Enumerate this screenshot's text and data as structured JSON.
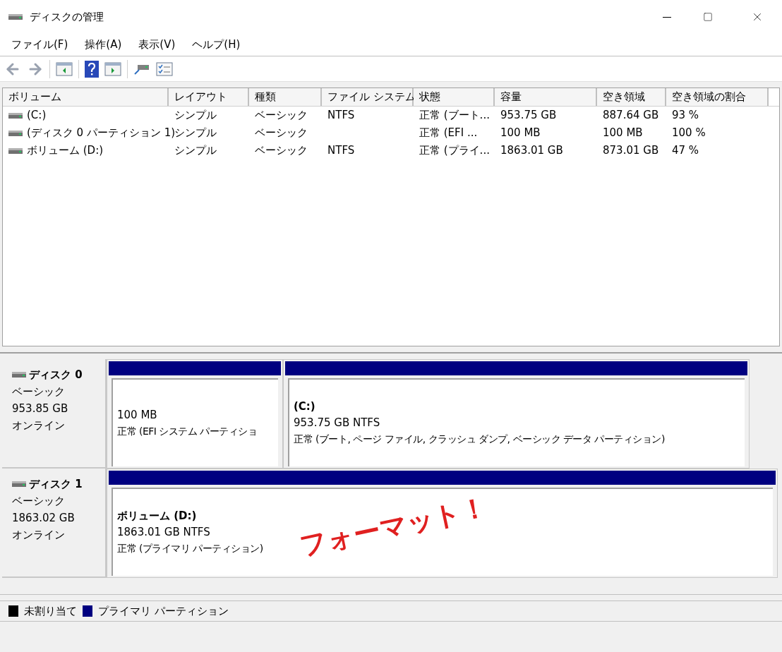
{
  "window": {
    "title": "ディスクの管理"
  },
  "menu": [
    "ファイル(F)",
    "操作(A)",
    "表示(V)",
    "ヘルプ(H)"
  ],
  "table": {
    "columns": [
      "ボリューム",
      "レイアウト",
      "種類",
      "ファイル システム",
      "状態",
      "容量",
      "空き領域",
      "空き領域の割合"
    ],
    "rows": [
      [
        "(C:)",
        "シンプル",
        "ベーシック",
        "NTFS",
        "正常 (ブート...",
        "953.75 GB",
        "887.64 GB",
        "93 %"
      ],
      [
        "(ディスク 0 パーティション 1)",
        "シンプル",
        "ベーシック",
        "",
        "正常 (EFI ...",
        "100 MB",
        "100 MB",
        "100 %"
      ],
      [
        "ボリューム (D:)",
        "シンプル",
        "ベーシック",
        "NTFS",
        "正常 (プライ...",
        "1863.01 GB",
        "873.01 GB",
        "47 %"
      ]
    ]
  },
  "disks": [
    {
      "name": "ディスク 0",
      "type": "ベーシック",
      "size": "953.85 GB",
      "status": "オンライン",
      "partitions": [
        {
          "kind": "primary",
          "size": "100 MB",
          "status": "正常 (EFI システム パーティショ"
        },
        {
          "kind": "primary",
          "label": "(C:)",
          "size": "953.75 GB NTFS",
          "status": "正常 (ブート, ページ ファイル, クラッシュ ダンプ, ベーシック データ パーティション)"
        }
      ]
    },
    {
      "name": "ディスク 1",
      "type": "ベーシック",
      "size": "1863.02 GB",
      "status": "オンライン",
      "partitions": [
        {
          "kind": "primary",
          "label": "ボリューム (D:)",
          "size": "1863.01 GB NTFS",
          "status": "正常 (プライマリ パーティション)",
          "annotation": "フォーマット！"
        }
      ]
    }
  ],
  "legend": [
    {
      "label": "未割り当て",
      "color": "#000000"
    },
    {
      "label": "プライマリ パーティション",
      "color": "#000080"
    }
  ]
}
